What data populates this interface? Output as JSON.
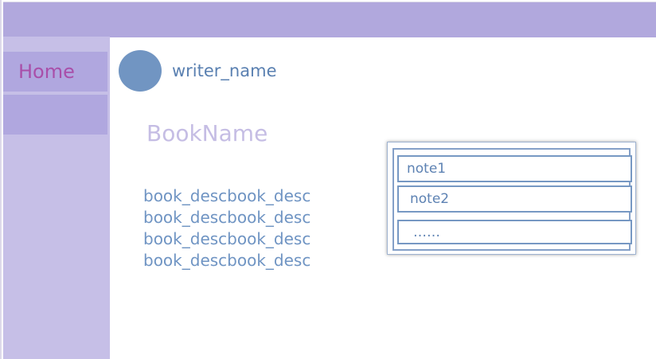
{
  "sidebar": {
    "items": [
      {
        "label": "Home"
      },
      {
        "label": ""
      }
    ]
  },
  "writer": {
    "name": "writer_name"
  },
  "book": {
    "name": "BookName",
    "description_lines": [
      "book_descbook_desc",
      "book_descbook_desc",
      "book_descbook_desc",
      "book_descbook_desc"
    ]
  },
  "notes": {
    "items": [
      {
        "label": "note1"
      },
      {
        "label": "note2"
      },
      {
        "label": "……"
      }
    ]
  },
  "colors": {
    "topbar": "#b1a8dd",
    "sidebar": "#c6bfe7",
    "nav_item": "#b0a7df",
    "home_text": "#a94fa9",
    "avatar": "#7195c2",
    "link_text": "#5a80b1",
    "book_name": "#c5bde4",
    "description": "#6f94c3",
    "note_border": "#7698c3"
  }
}
